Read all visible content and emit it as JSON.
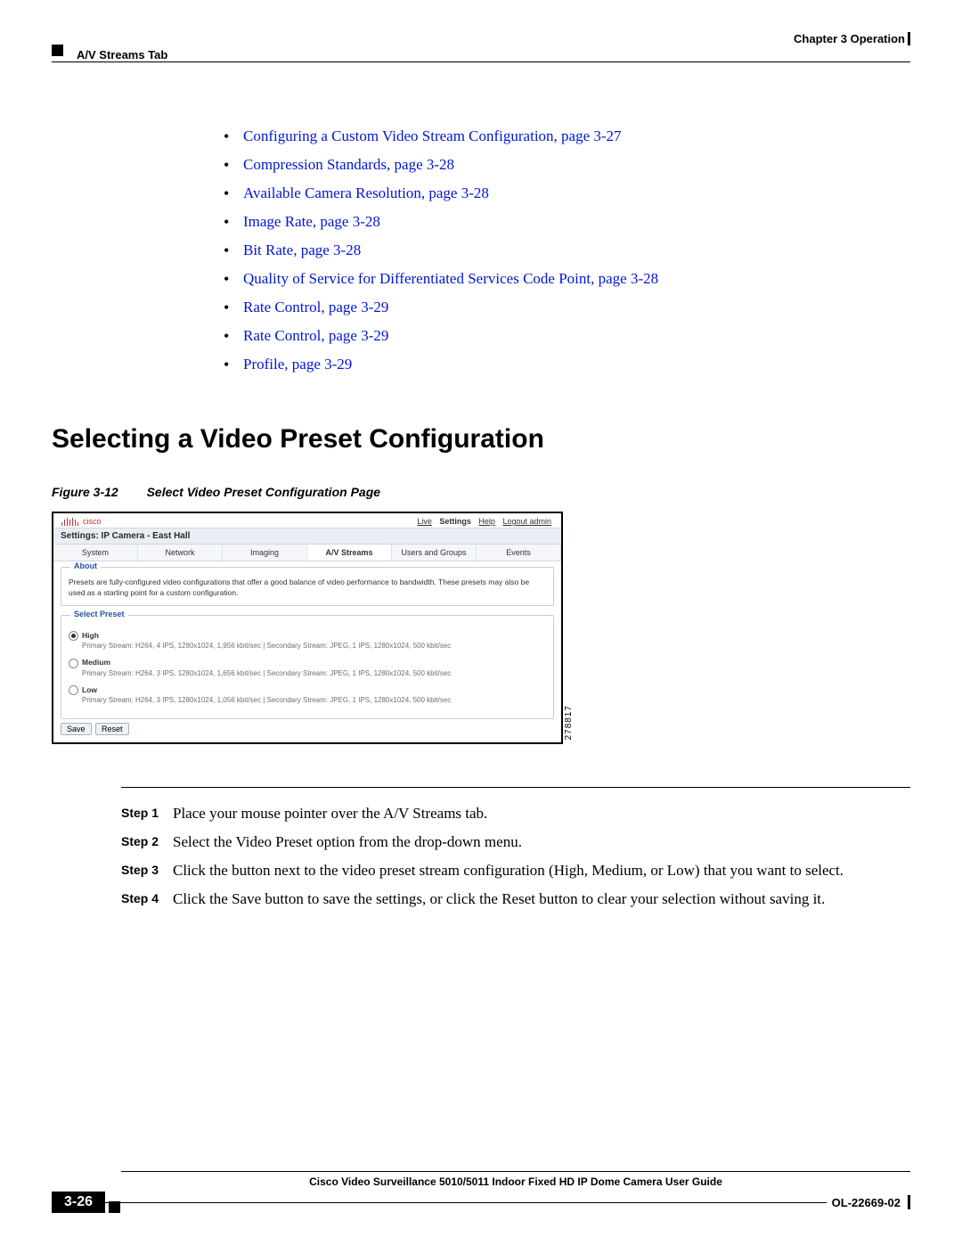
{
  "header": {
    "chapter": "Chapter 3    Operation",
    "subtitle": "A/V Streams Tab"
  },
  "links": [
    "Configuring a Custom Video Stream Configuration, page 3-27",
    "Compression Standards, page 3-28",
    "Available Camera Resolution, page 3-28",
    "Image Rate, page 3-28",
    "Bit Rate, page 3-28",
    "Quality of Service for Differentiated Services Code Point, page 3-28",
    "Rate Control, page 3-29",
    "Rate Control, page 3-29",
    "Profile, page 3-29"
  ],
  "section_heading": "Selecting a Video Preset Configuration",
  "figure": {
    "label": "Figure 3-12",
    "caption": "Select Video Preset Configuration Page",
    "id": "278817",
    "logo_text": "cisco",
    "toplinks": {
      "live": "Live",
      "settings": "Settings",
      "help": "Help",
      "logout": "Logout admin"
    },
    "breadcrumb": "Settings: IP Camera - East Hall",
    "tabs": [
      "System",
      "Network",
      "Imaging",
      "A/V Streams",
      "Users and Groups",
      "Events"
    ],
    "active_tab": 3,
    "about_title": "About",
    "about_text": "Presets are fully-configured video configurations that offer a good balance of video performance to bandwidth. These presets may also be used as a starting point for a custom configuration.",
    "select_title": "Select Preset",
    "presets": [
      {
        "name": "High",
        "on": true,
        "desc": "Primary Stream: H264, 4 IPS, 1280x1024, 1,956 kbit/sec | Secondary Stream: JPEG, 1 IPS, 1280x1024, 500 kbit/sec"
      },
      {
        "name": "Medium",
        "on": false,
        "desc": "Primary Stream: H264, 3 IPS, 1280x1024, 1,656 kbit/sec | Secondary Stream: JPEG, 1 IPS, 1280x1024, 500 kbit/sec"
      },
      {
        "name": "Low",
        "on": false,
        "desc": "Primary Stream: H264, 3 IPS, 1280x1024, 1,056 kbit/sec | Secondary Stream: JPEG, 1 IPS, 1280x1024, 500 kbit/sec"
      }
    ],
    "save": "Save",
    "reset": "Reset"
  },
  "steps": [
    {
      "label": "Step 1",
      "text": "Place your mouse pointer over the A/V Streams tab."
    },
    {
      "label": "Step 2",
      "text": "Select the Video Preset option from the drop-down menu."
    },
    {
      "label": "Step 3",
      "text": "Click the button next to the video preset stream configuration (High, Medium, or Low) that you want to select."
    },
    {
      "label": "Step 4",
      "text": "Click the Save button to save the settings, or click the Reset button to clear your selection without saving it."
    }
  ],
  "footer": {
    "title": "Cisco Video Surveillance 5010/5011 Indoor Fixed HD IP Dome Camera User Guide",
    "page": "3-26",
    "doc": "OL-22669-02"
  }
}
